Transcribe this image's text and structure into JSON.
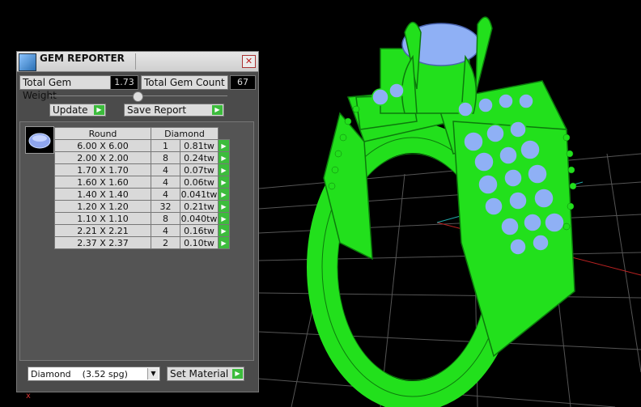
{
  "window": {
    "title": "GEM REPORTER",
    "close_glyph": "✕"
  },
  "stats": {
    "total_weight_label": "Total Gem Weight",
    "total_weight_value": "1.73",
    "total_count_label": "Total Gem Count",
    "total_count_value": "67"
  },
  "actions": {
    "update_label": "Update",
    "save_label": "Save Report",
    "arrow_glyph": "▶"
  },
  "table": {
    "columns": [
      "Round",
      "Diamond"
    ],
    "rows": [
      {
        "size": "6.00 X 6.00",
        "count": "1",
        "weight": "0.81tw"
      },
      {
        "size": "2.00 X 2.00",
        "count": "8",
        "weight": "0.24tw"
      },
      {
        "size": "1.70 X 1.70",
        "count": "4",
        "weight": "0.07tw"
      },
      {
        "size": "1.60 X 1.60",
        "count": "4",
        "weight": "0.06tw"
      },
      {
        "size": "1.40 X 1.40",
        "count": "4",
        "weight": "0.041tw"
      },
      {
        "size": "1.20 X 1.20",
        "count": "32",
        "weight": "0.21tw"
      },
      {
        "size": "1.10 X 1.10",
        "count": "8",
        "weight": "0.040tw"
      },
      {
        "size": "2.21 X 2.21",
        "count": "4",
        "weight": "0.16tw"
      },
      {
        "size": "2.37 X 2.37",
        "count": "2",
        "weight": "0.10tw"
      }
    ]
  },
  "material": {
    "selected": "Diamond    (3.52 spg)",
    "set_label": "Set Material",
    "dropdown_glyph": "▼"
  },
  "viewport": {
    "axis_label": "x",
    "model_color": "#22e01c",
    "gem_color": "#8fb0f5"
  }
}
